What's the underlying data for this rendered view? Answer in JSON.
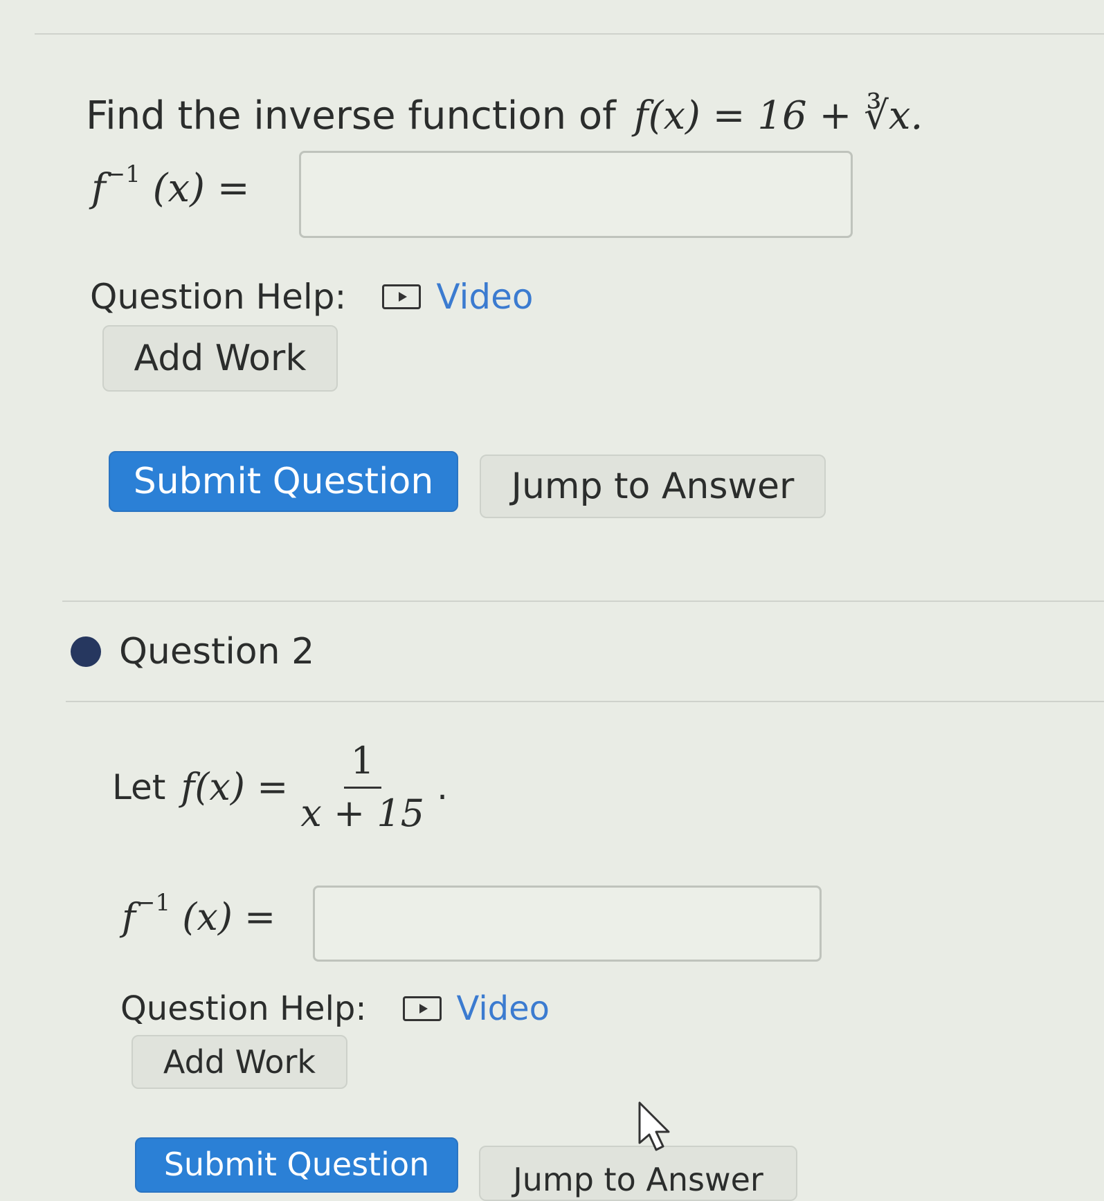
{
  "question1": {
    "prompt": "Find the inverse function of",
    "function": "f(x) = 16 + ∛x.",
    "answer_label_base": "f",
    "answer_label_exp": "−1",
    "answer_label_rest": "(x) =",
    "answer_value": "",
    "help_label": "Question Help:",
    "video_label": "Video",
    "add_work_label": "Add Work",
    "submit_label": "Submit Question",
    "jump_label": "Jump to Answer"
  },
  "question2": {
    "header": "Question 2",
    "prompt": "Let",
    "function_lhs": "f(x) =",
    "fraction_numerator": "1",
    "fraction_denominator": "x + 15",
    "trailing": ".",
    "answer_label_base": "f",
    "answer_label_exp": "−1",
    "answer_label_rest": "(x) =",
    "answer_value": "",
    "help_label": "Question Help:",
    "video_label": "Video",
    "add_work_label": "Add Work",
    "submit_label": "Submit Question",
    "jump_label": "Jump to Answer"
  },
  "colors": {
    "accent_blue": "#2b80d6",
    "link_blue": "#3b7bd0",
    "status_dot": "#26375f"
  },
  "icons": {
    "video": "play-icon",
    "status": "circle-dot-icon",
    "pointer": "mouse-cursor-icon"
  }
}
